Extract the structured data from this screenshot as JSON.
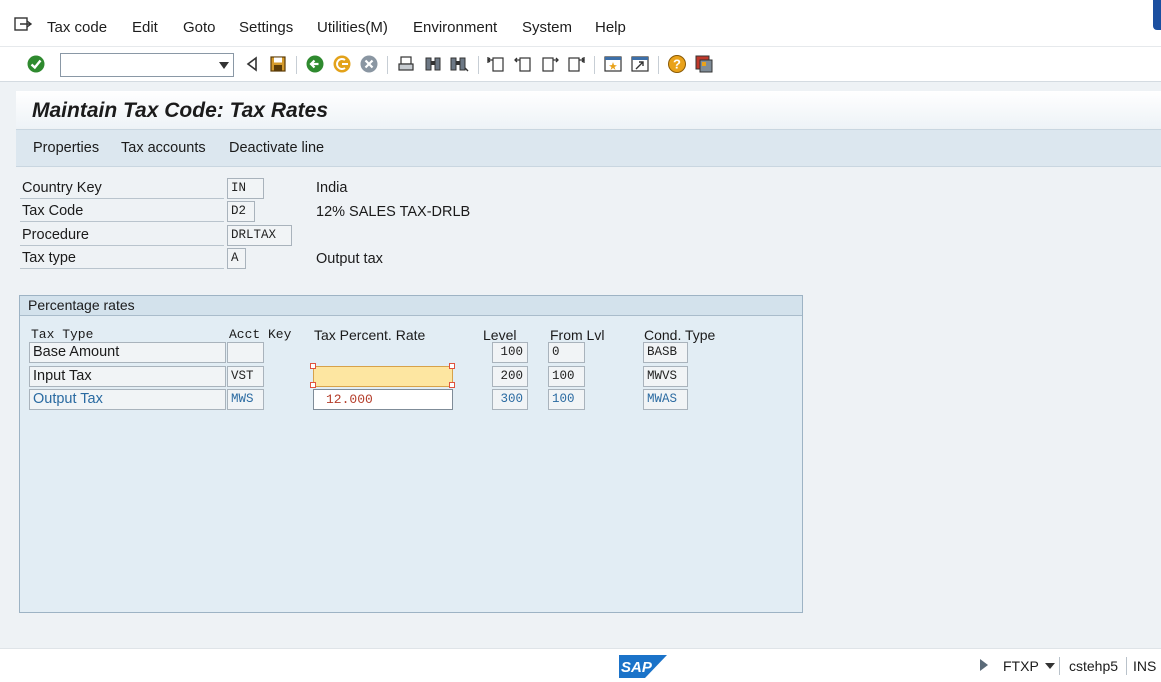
{
  "menu": {
    "items": [
      "Tax code",
      "Edit",
      "Goto",
      "Settings",
      "Utilities(M)",
      "Environment",
      "System",
      "Help"
    ]
  },
  "toolbar": {
    "command_value": "",
    "icons": [
      "enter-check-icon",
      "command-dropdown",
      "back-triangle-icon",
      "save-icon",
      "back-icon",
      "exit-icon",
      "cancel-icon",
      "print-icon",
      "find-icon",
      "find-next-icon",
      "first-page-icon",
      "previous-page-icon",
      "next-page-icon",
      "last-page-icon",
      "create-session-icon",
      "shortcut-icon",
      "help-icon",
      "customize-layout-icon"
    ]
  },
  "title": "Maintain Tax Code: Tax Rates",
  "app_toolbar": {
    "properties": "Properties",
    "tax_accounts": "Tax accounts",
    "deactivate_line": "Deactivate line"
  },
  "header": {
    "country_key_label": "Country Key",
    "country_key": "IN",
    "country_desc": "India",
    "tax_code_label": "Tax Code",
    "tax_code": "D2",
    "tax_code_desc": "12% SALES TAX-DRLB",
    "procedure_label": "Procedure",
    "procedure": "DRLTAX",
    "tax_type_label": "Tax type",
    "tax_type": "A",
    "tax_type_desc": "Output tax"
  },
  "rates": {
    "group_title": "Percentage rates",
    "columns": {
      "tax_type": "Tax Type",
      "acct_key": "Acct Key",
      "rate": "Tax Percent. Rate",
      "level": "Level",
      "from_lvl": "From Lvl",
      "cond_type": "Cond. Type"
    },
    "rows": [
      {
        "tax_type": "Base Amount",
        "acct_key": "",
        "rate": "",
        "level": "100",
        "from_lvl": "0",
        "cond_type": "BASB"
      },
      {
        "tax_type": "Input Tax",
        "acct_key": "VST",
        "rate": "",
        "level": "200",
        "from_lvl": "100",
        "cond_type": "MWVS"
      },
      {
        "tax_type": "Output Tax",
        "acct_key": "MWS",
        "rate": "12.000",
        "level": "300",
        "from_lvl": "100",
        "cond_type": "MWAS"
      }
    ]
  },
  "status": {
    "logo": "SAP",
    "transaction": "FTXP",
    "server": "cstehp5",
    "mode": "INS"
  },
  "colors": {
    "accent_blue": "#2a6aa1",
    "focus_yellow": "#fde6a1",
    "value_red": "#b43d2a",
    "sap_blue": "#1b73c9"
  }
}
